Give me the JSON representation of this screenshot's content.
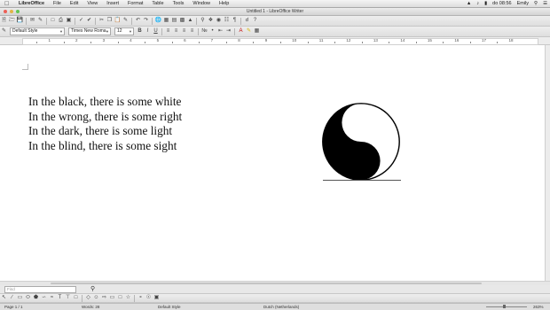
{
  "menubar": {
    "app": "LibreOffice",
    "items": [
      "File",
      "Edit",
      "View",
      "Insert",
      "Format",
      "Table",
      "Tools",
      "Window",
      "Help"
    ],
    "clock": "do 08:56",
    "user": "Emily"
  },
  "window": {
    "title": "Untitled 1 - LibreOffice Writer"
  },
  "formatting": {
    "paragraph_style": "Default Style",
    "font_name": "Times New Roma",
    "font_size": "12"
  },
  "ruler": {
    "numbers": [
      "1",
      "2",
      "3",
      "4",
      "5",
      "6",
      "7",
      "8",
      "9",
      "10",
      "11",
      "12",
      "13",
      "14",
      "15",
      "16",
      "17",
      "18"
    ]
  },
  "document": {
    "lines": [
      "In the black, there is some white",
      "In the wrong, there is some right",
      "In the dark, there is some light",
      "In the blind, there is some sight"
    ]
  },
  "findbar": {
    "placeholder": "Find"
  },
  "statusbar": {
    "page": "Page 1 / 1",
    "words": "Words: 28",
    "style": "Default Style",
    "language": "Dutch (Netherlands)",
    "zoom": "263%"
  }
}
